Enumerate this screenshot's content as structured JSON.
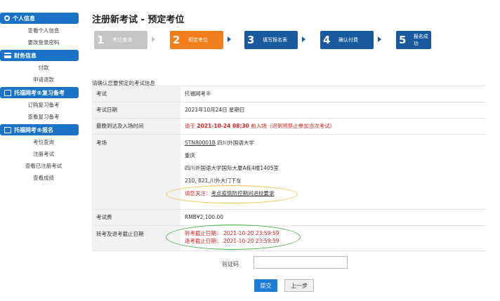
{
  "sidebar": {
    "sections": [
      {
        "title": "个人信息",
        "icon": "user-icon",
        "items": [
          "查看个人信息",
          "更改登录密码"
        ]
      },
      {
        "title": "财务信息",
        "icon": "card-icon",
        "items": [
          "付款",
          "申请退款"
        ]
      },
      {
        "title": "托福网考®复习备考",
        "icon": "book-icon",
        "items": [
          "订购复习备考",
          "查看复习备考"
        ]
      },
      {
        "title": "托福网考®报名",
        "icon": "book-icon",
        "items": [
          "考位查询",
          "注册考试",
          "查看已注册考试",
          "查看成绩"
        ]
      }
    ]
  },
  "page_title": "注册新考试 - 预定考位",
  "steps": [
    {
      "num": "1",
      "label": "考位查询",
      "state": "done"
    },
    {
      "num": "2",
      "label": "预定考位",
      "state": "current"
    },
    {
      "num": "3",
      "label": "填写报名表",
      "state": "todo"
    },
    {
      "num": "4",
      "label": "确认付费",
      "state": "todo"
    },
    {
      "num": "5",
      "label": "报名成功",
      "state": "todo"
    }
  ],
  "confirm_label": "请确认您要预定的考试信息",
  "info": {
    "exam_key": "考试",
    "exam_val": "托福网考®",
    "date_key": "考试日期",
    "date_val": "2021年10月24日 星期日",
    "arrival_key": "最晚到达及入场时间",
    "arrival_prefix": "请于 ",
    "arrival_time": "2021-10-24 08:30",
    "arrival_suffix": " 前入场（迟到将禁止参加当次考试）",
    "center_key": "考场",
    "center_code": "STN80001B",
    "center_name": " 四川外国语大学",
    "center_city": "重庆",
    "center_addr1": "四川外国语大学国际大厦A栋4楼1405室",
    "center_addr2": "210, 821,川外大门下车",
    "notice_prefix": "请您关注：",
    "notice_link": "考点疫情防控期间进校要求",
    "fee_key": "考试费",
    "fee_val": "RMB¥2,100.00",
    "deadline_key": "转考及退考截止日期",
    "transfer_deadline": "转考截止日期：  2021-10-20 23:59:59",
    "refund_deadline": "退考截止日期：  2021-10-20 23:59:59"
  },
  "captcha_label": "验证码",
  "captcha_value": "",
  "buttons": {
    "submit": "提交",
    "prev": "上一步"
  },
  "colors": {
    "primary": "#1a73c6",
    "step_current": "#f27f1b",
    "step_todo": "#195a9f",
    "warning_red": "#e02020",
    "yellow_ellipse": "#f3c244",
    "green_ellipse": "#4ab84a"
  }
}
